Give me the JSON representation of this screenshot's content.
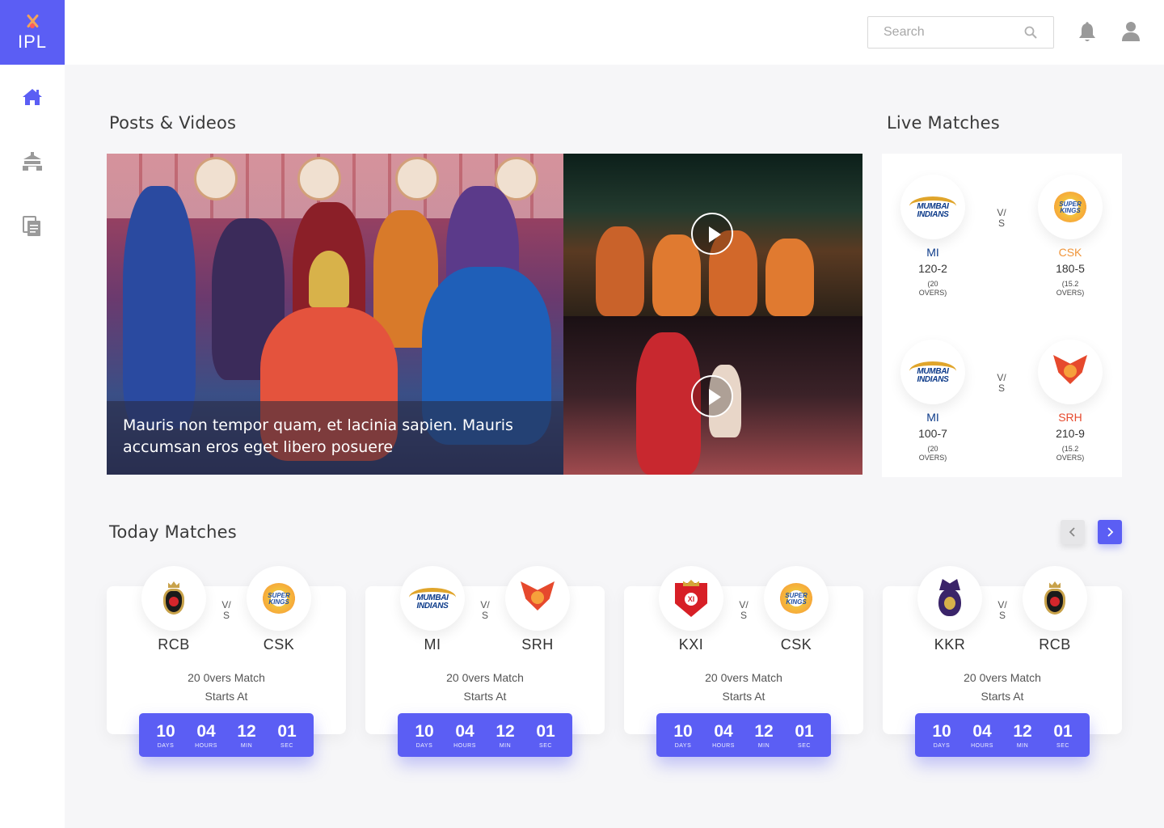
{
  "brand": {
    "name": "IPL"
  },
  "search": {
    "placeholder": "Search"
  },
  "sidebar": {
    "items": [
      "home",
      "stadium",
      "documents"
    ]
  },
  "sections": {
    "posts": "Posts & Videos",
    "live": "Live Matches",
    "today": "Today Matches"
  },
  "post": {
    "caption": "Mauris non tempor quam, et lacinia sapien. Mauris accumsan eros eget libero posuere"
  },
  "live_matches": [
    {
      "vs": [
        "V/",
        "S"
      ],
      "team1": {
        "abbr": "MI",
        "score": "120-2",
        "overs": [
          "(20",
          "OVERS)"
        ],
        "logo": "mi",
        "color": "#0c3a89"
      },
      "team2": {
        "abbr": "CSK",
        "score": "180-5",
        "overs": [
          "(15.2",
          "OVERS)"
        ],
        "logo": "csk",
        "color": "#f0953a"
      }
    },
    {
      "vs": [
        "V/",
        "S"
      ],
      "team1": {
        "abbr": "MI",
        "score": "100-7",
        "overs": [
          "(20",
          "OVERS)"
        ],
        "logo": "mi",
        "color": "#0c3a89"
      },
      "team2": {
        "abbr": "SRH",
        "score": "210-9",
        "overs": [
          "(15.2",
          "OVERS)"
        ],
        "logo": "srh",
        "color": "#e6492d"
      }
    }
  ],
  "today_matches": [
    {
      "team1": "RCB",
      "team2": "CSK",
      "logo1": "rcb",
      "logo2": "csk",
      "vs": [
        "V/",
        "S"
      ],
      "format": "20 0vers Match",
      "starts": "Starts At",
      "timer": [
        {
          "n": "10",
          "l": "DAYS"
        },
        {
          "n": "04",
          "l": "HOURS"
        },
        {
          "n": "12",
          "l": "MIN"
        },
        {
          "n": "01",
          "l": "SEC"
        }
      ]
    },
    {
      "team1": "MI",
      "team2": "SRH",
      "logo1": "mi",
      "logo2": "srh",
      "vs": [
        "V/",
        "S"
      ],
      "format": "20 0vers Match",
      "starts": "Starts At",
      "timer": [
        {
          "n": "10",
          "l": "DAYS"
        },
        {
          "n": "04",
          "l": "HOURS"
        },
        {
          "n": "12",
          "l": "MIN"
        },
        {
          "n": "01",
          "l": "SEC"
        }
      ]
    },
    {
      "team1": "KXI",
      "team2": "CSK",
      "logo1": "kxi",
      "logo2": "csk",
      "vs": [
        "V/",
        "S"
      ],
      "format": "20 0vers Match",
      "starts": "Starts At",
      "timer": [
        {
          "n": "10",
          "l": "DAYS"
        },
        {
          "n": "04",
          "l": "HOURS"
        },
        {
          "n": "12",
          "l": "MIN"
        },
        {
          "n": "01",
          "l": "SEC"
        }
      ]
    },
    {
      "team1": "KKR",
      "team2": "RCB",
      "logo1": "kkr",
      "logo2": "rcb",
      "vs": [
        "V/",
        "S"
      ],
      "format": "20 0vers Match",
      "starts": "Starts At",
      "timer": [
        {
          "n": "10",
          "l": "DAYS"
        },
        {
          "n": "04",
          "l": "HOURS"
        },
        {
          "n": "12",
          "l": "MIN"
        },
        {
          "n": "01",
          "l": "SEC"
        }
      ]
    }
  ],
  "colors": {
    "accent": "#5b5ef4"
  }
}
